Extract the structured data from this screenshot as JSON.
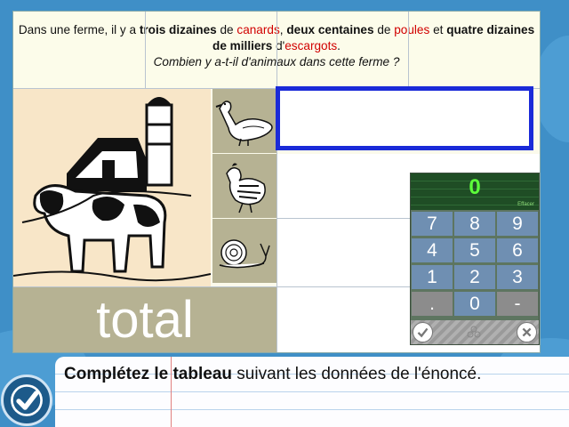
{
  "statement": {
    "part1": "Dans une ferme, il y a ",
    "b1": "trois dizaines",
    "part2": " de ",
    "r1": "canards",
    "part3": ", ",
    "b2": "deux centaines",
    "part4": " de ",
    "r2": "poules",
    "part5": " et ",
    "b3": "quatre dizaines de milliers",
    "part6": " d'",
    "r3": "escargots",
    "part7": ".",
    "question": "Combien y a-t-il d'animaux dans cette ferme ?"
  },
  "table": {
    "total_label": "total",
    "animals": [
      "duck-icon",
      "hen-icon",
      "snail-icon"
    ]
  },
  "keypad": {
    "display": "0",
    "clear_label": "Effacer",
    "keys": [
      "7",
      "8",
      "9",
      "4",
      "5",
      "6",
      "1",
      "2",
      "3",
      ".",
      "0",
      "-"
    ]
  },
  "instruction": {
    "bold": "Complétez le tableau",
    "rest": " suivant les données de l'énoncé."
  },
  "colors": {
    "active_border": "#1a2ad8",
    "display_digit": "#5cff3a",
    "keypad_key": "#6f8fb2"
  }
}
